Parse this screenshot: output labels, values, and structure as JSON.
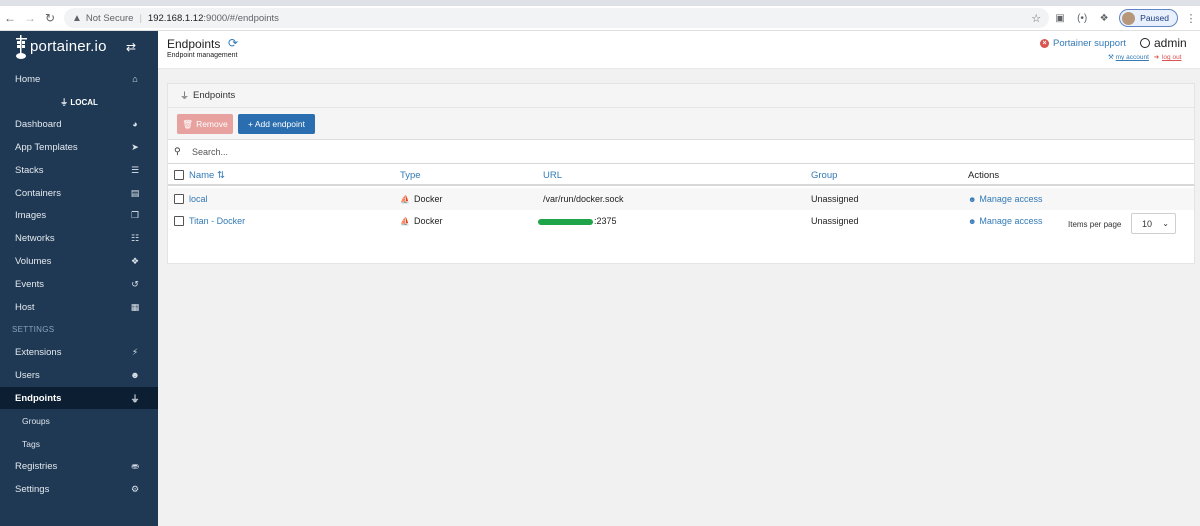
{
  "browser": {
    "not_secure": "Not Secure",
    "host": "192.168.1.12",
    "path": ":9000/#/endpoints",
    "profile_label": "Paused"
  },
  "sidebar": {
    "brand": "portainer.io",
    "endpoint_name": "LOCAL",
    "items_top": [
      {
        "label": "Home",
        "icon": "home-icon"
      }
    ],
    "items_endpoint": [
      {
        "label": "Dashboard",
        "icon": "tachometer-icon"
      },
      {
        "label": "App Templates",
        "icon": "rocket-icon"
      },
      {
        "label": "Stacks",
        "icon": "th-list-icon"
      },
      {
        "label": "Containers",
        "icon": "server-icon"
      },
      {
        "label": "Images",
        "icon": "clone-icon"
      },
      {
        "label": "Networks",
        "icon": "sitemap-icon"
      },
      {
        "label": "Volumes",
        "icon": "cubes-icon"
      },
      {
        "label": "Events",
        "icon": "history-icon"
      },
      {
        "label": "Host",
        "icon": "th-icon"
      }
    ],
    "settings_label": "SETTINGS",
    "items_settings": [
      {
        "label": "Extensions",
        "icon": "bolt-icon"
      },
      {
        "label": "Users",
        "icon": "users-icon"
      },
      {
        "label": "Endpoints",
        "icon": "plug-icon",
        "active": true
      }
    ],
    "endpoints_subitems": [
      "Groups",
      "Tags"
    ],
    "items_bottom": [
      {
        "label": "Registries",
        "icon": "database-icon"
      },
      {
        "label": "Settings",
        "icon": "cogs-icon"
      }
    ]
  },
  "header": {
    "title": "Endpoints",
    "subtitle": "Endpoint management",
    "support": "Portainer support",
    "user": "admin",
    "my_account": "my account",
    "log_out": "log out"
  },
  "widget": {
    "title": "Endpoints",
    "remove_label": "Remove",
    "add_label": "+ Add endpoint",
    "search_placeholder": "Search...",
    "columns": {
      "name": "Name",
      "type": "Type",
      "url": "URL",
      "group": "Group",
      "actions": "Actions"
    },
    "rows": [
      {
        "name": "local",
        "type": "Docker",
        "url": "/var/run/docker.sock",
        "url_redacted": false,
        "group": "Unassigned",
        "action": "Manage access"
      },
      {
        "name": "Titan - Docker",
        "type": "Docker",
        "url": ":2375",
        "url_redacted": true,
        "group": "Unassigned",
        "action": "Manage access"
      }
    ],
    "items_per_page_label": "Items per page",
    "items_per_page_value": "10"
  },
  "colors": {
    "sidebar_bg": "#1f3955",
    "link": "#337ab7",
    "danger": "#d9534f",
    "primary": "#2a6eb0",
    "redaction": "#1fa44a"
  }
}
